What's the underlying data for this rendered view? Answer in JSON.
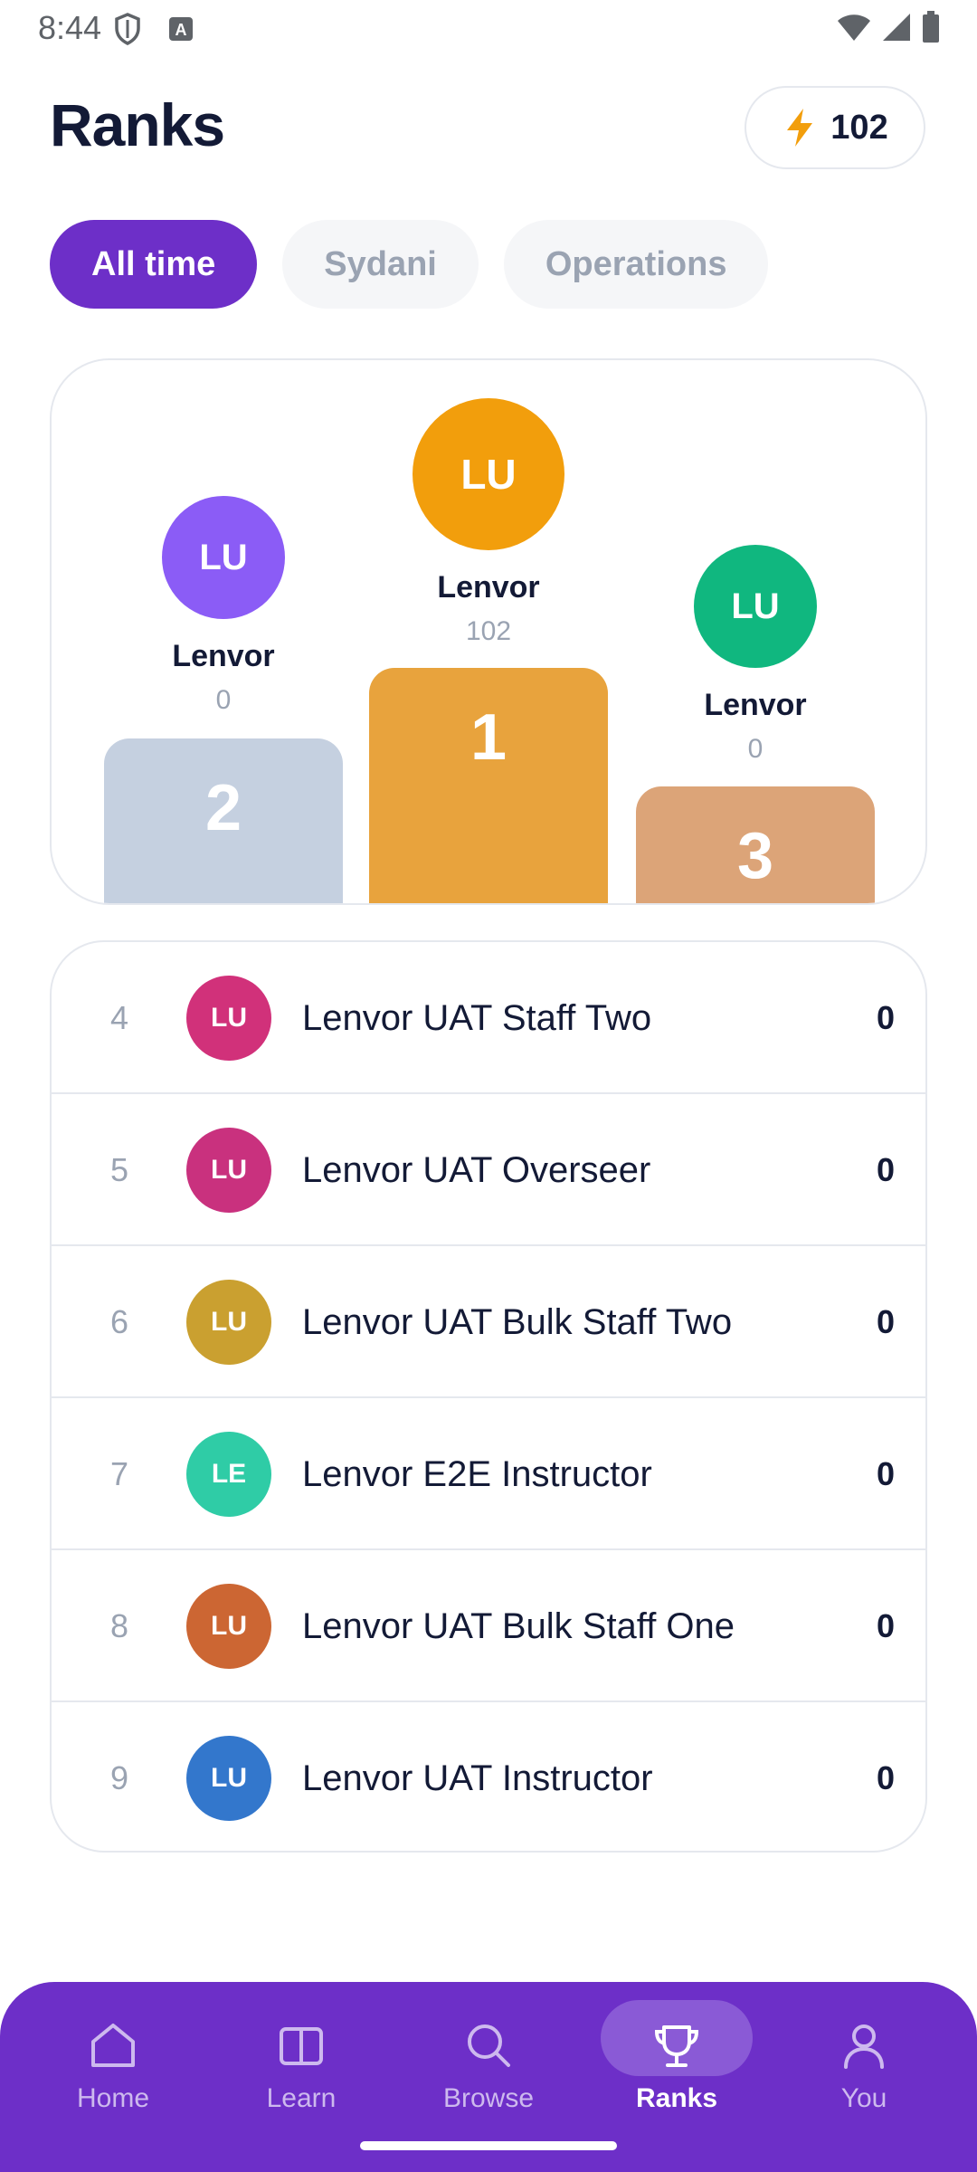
{
  "status_bar": {
    "time": "8:44"
  },
  "header": {
    "title": "Ranks",
    "points": "102"
  },
  "filters": [
    {
      "label": "All time",
      "active": true
    },
    {
      "label": "Sydani",
      "active": false
    },
    {
      "label": "Operations",
      "active": false
    }
  ],
  "podium": {
    "first": {
      "initials": "LU",
      "name": "Lenvor",
      "score": "102",
      "rank": "1",
      "avatar_color": "#f29e0c",
      "block_color": "#e8a33d"
    },
    "second": {
      "initials": "LU",
      "name": "Lenvor",
      "score": "0",
      "rank": "2",
      "avatar_color": "#8b5cf6",
      "block_color": "#c5d0e0"
    },
    "third": {
      "initials": "LU",
      "name": "Lenvor",
      "score": "0",
      "rank": "3",
      "avatar_color": "#10b77f",
      "block_color": "#dca478"
    }
  },
  "rankings": [
    {
      "rank": "4",
      "initials": "LU",
      "name": "Lenvor UAT Staff Two",
      "score": "0",
      "color": "#d1317a"
    },
    {
      "rank": "5",
      "initials": "LU",
      "name": "Lenvor UAT Overseer",
      "score": "0",
      "color": "#c9317e"
    },
    {
      "rank": "6",
      "initials": "LU",
      "name": "Lenvor UAT Bulk Staff Two",
      "score": "0",
      "color": "#caa030"
    },
    {
      "rank": "7",
      "initials": "LE",
      "name": "Lenvor E2E Instructor",
      "score": "0",
      "color": "#2fcca6"
    },
    {
      "rank": "8",
      "initials": "LU",
      "name": "Lenvor UAT Bulk Staff One",
      "score": "0",
      "color": "#cc6633"
    },
    {
      "rank": "9",
      "initials": "LU",
      "name": "Lenvor UAT Instructor",
      "score": "0",
      "color": "#3377cc"
    }
  ],
  "bottom_nav": {
    "items": [
      {
        "label": "Home",
        "icon": "home-icon"
      },
      {
        "label": "Learn",
        "icon": "book-icon"
      },
      {
        "label": "Browse",
        "icon": "search-icon"
      },
      {
        "label": "Ranks",
        "icon": "trophy-icon",
        "active": true
      },
      {
        "label": "You",
        "icon": "user-icon"
      }
    ]
  },
  "colors": {
    "accent": "#6d2fc8",
    "bolt": "#f29e0c"
  }
}
